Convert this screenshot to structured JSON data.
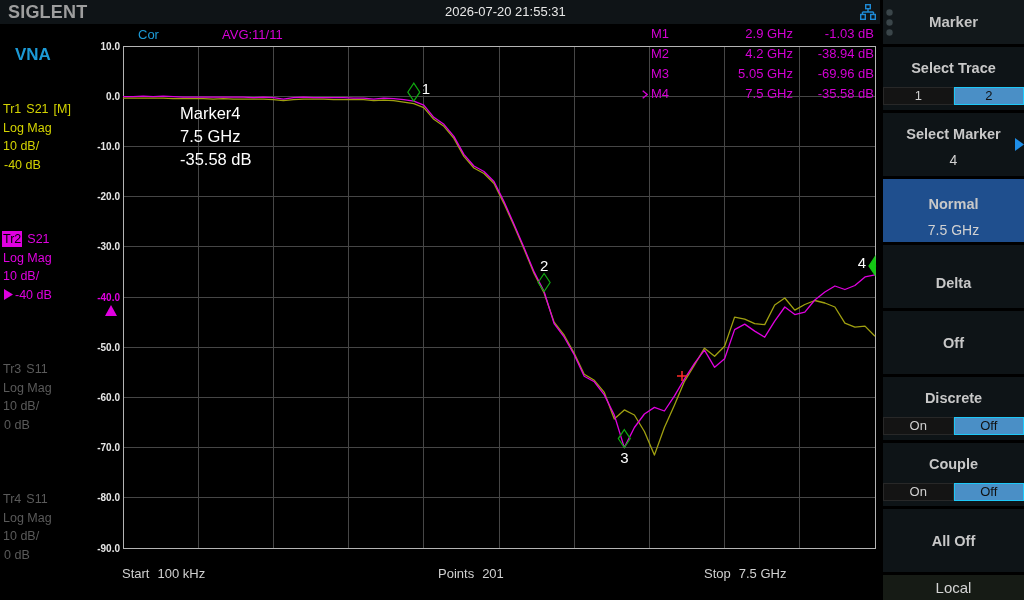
{
  "topbar": {
    "logo": "SIGLENT",
    "datetime": "2026-07-20 21:55:31"
  },
  "mode": "VNA",
  "traces": [
    {
      "name": "Tr1",
      "parameter": "S21",
      "flag": "[M]",
      "format": "Log Mag",
      "scale": "10 dB/",
      "reference": "-40 dB",
      "color": "#d4d400",
      "enabled": true,
      "selected": false
    },
    {
      "name": "Tr2",
      "parameter": "S21",
      "format": "Log Mag",
      "scale": "10 dB/",
      "reference": "-40 dB",
      "color": "#e000e0",
      "enabled": true,
      "selected": true
    },
    {
      "name": "Tr3",
      "parameter": "S11",
      "format": "Log Mag",
      "scale": "10 dB/",
      "reference": "0 dB",
      "enabled": false,
      "selected": false
    },
    {
      "name": "Tr4",
      "parameter": "S11",
      "format": "Log Mag",
      "scale": "10 dB/",
      "reference": "0 dB",
      "enabled": false,
      "selected": false
    }
  ],
  "plot": {
    "correction": "Cor",
    "averaging": "AVG:11/11",
    "markers": [
      {
        "name": "M1",
        "frequency": "2.9 GHz",
        "value": "-1.03 dB",
        "selected": false
      },
      {
        "name": "M2",
        "frequency": "4.2 GHz",
        "value": "-38.94 dB",
        "selected": false
      },
      {
        "name": "M3",
        "frequency": "5.05 GHz",
        "value": "-69.96 dB",
        "selected": false
      },
      {
        "name": "M4",
        "frequency": "7.5 GHz",
        "value": "-35.58 dB",
        "selected": true
      }
    ],
    "readout": {
      "title": "Marker4",
      "frequency": "7.5 GHz",
      "value": "-35.58 dB"
    },
    "chart_data": {
      "type": "line",
      "grid": true,
      "categories": [
        null,
        null,
        null,
        null,
        null,
        null,
        null,
        null,
        null,
        null,
        null,
        null,
        null,
        null,
        null,
        null,
        null,
        null,
        null,
        null,
        null,
        null,
        null,
        null,
        null,
        null,
        null,
        null,
        null,
        null,
        null,
        null,
        null,
        null,
        null,
        null,
        null,
        null,
        null,
        null,
        null,
        null,
        null,
        null,
        null,
        null,
        null,
        null,
        null,
        null,
        null,
        null,
        null,
        null,
        null,
        null,
        null,
        null,
        null,
        null,
        null,
        null,
        null,
        null,
        null,
        null,
        null,
        null,
        null,
        null,
        null,
        null,
        null,
        null,
        null,
        null
      ],
      "ylim": [
        -90,
        10
      ],
      "yticks": [
        {
          "value": 10,
          "label": "10.0"
        },
        {
          "value": 0,
          "label": "0.0"
        },
        {
          "value": -10,
          "label": "-10.0"
        },
        {
          "value": -20,
          "label": "-20.0"
        },
        {
          "value": -30,
          "label": "-30.0"
        },
        {
          "value": -40,
          "label": "-40.0"
        },
        {
          "value": -50,
          "label": "-50.0"
        },
        {
          "value": -60,
          "label": "-60.0"
        },
        {
          "value": -70,
          "label": "-70.0"
        },
        {
          "value": -80,
          "label": "-80.0"
        },
        {
          "value": -90,
          "label": "-90.0"
        }
      ],
      "series": [
        {
          "color": "#a0a010",
          "values": [
            -0.4,
            -0.4,
            -0.4,
            -0.4,
            -0.4,
            -0.5,
            -0.5,
            -0.5,
            -0.5,
            -0.6,
            -0.5,
            -0.6,
            -0.6,
            -0.6,
            -0.6,
            -0.7,
            -0.9,
            -0.7,
            -0.6,
            -0.6,
            -0.6,
            -0.7,
            -0.7,
            -0.7,
            -0.7,
            -0.9,
            -0.8,
            -0.9,
            -1.2,
            -1.5,
            -2.3,
            -4.6,
            -6.0,
            -8.4,
            -12.0,
            -14.3,
            -15.4,
            -17.4,
            -21.4,
            -25.8,
            -30.5,
            -35.3,
            -39.2,
            -45.0,
            -47.6,
            -51.2,
            -55.4,
            -56.6,
            -59.0,
            -64.3,
            -62.5,
            -63.5,
            -66.8,
            -71.5,
            -66.0,
            -61.5,
            -56.8,
            -53.5,
            -50.2,
            -51.8,
            -49.8,
            -44.0,
            -44.4,
            -45.3,
            -45.5,
            -41.6,
            -40.2,
            -42.6,
            -41.5,
            -40.7,
            -41.2,
            -42.0,
            -45.2,
            -46.0,
            -45.8,
            -47.8
          ]
        },
        {
          "color": "#e000e0",
          "values": [
            -0.1,
            -0.1,
            0.0,
            -0.1,
            0.0,
            -0.1,
            -0.2,
            -0.2,
            -0.2,
            -0.2,
            -0.2,
            -0.2,
            -0.2,
            -0.3,
            -0.2,
            -0.3,
            -0.6,
            -0.3,
            -0.2,
            -0.3,
            -0.3,
            -0.3,
            -0.3,
            -0.4,
            -0.4,
            -0.6,
            -0.4,
            -0.5,
            -0.7,
            -1.0,
            -1.8,
            -4.2,
            -5.6,
            -8.0,
            -11.6,
            -13.9,
            -15.0,
            -17.0,
            -21.0,
            -25.5,
            -30.2,
            -35.0,
            -38.9,
            -45.3,
            -48.0,
            -51.5,
            -55.8,
            -56.9,
            -59.5,
            -63.5,
            -70.0,
            -66.0,
            -63.3,
            -62.0,
            -62.7,
            -59.7,
            -56.3,
            -53.2,
            -50.6,
            -54.0,
            -52.3,
            -46.5,
            -45.4,
            -46.8,
            -48.0,
            -44.8,
            -42.0,
            -43.5,
            -43.0,
            -40.6,
            -39.0,
            -37.8,
            -38.5,
            -37.7,
            -36.0,
            -35.6
          ]
        }
      ],
      "annotations": [
        {
          "text": "1",
          "y": -1.0
        },
        {
          "text": "2",
          "y": -38.9
        },
        {
          "text": "3",
          "y": -70.0
        },
        {
          "text": "4",
          "y": -35.6
        }
      ]
    },
    "sweep": {
      "start_label": "Start",
      "start": "100 kHz",
      "points_label": "Points",
      "points": "201",
      "stop_label": "Stop",
      "stop": "7.5 GHz"
    }
  },
  "softkeys": {
    "title": "Marker",
    "items": [
      {
        "kind": "toggle",
        "label": "Select Trace",
        "selected": false,
        "options": [
          {
            "label": "1",
            "selected": false
          },
          {
            "label": "2",
            "selected": true
          }
        ]
      },
      {
        "kind": "submenu",
        "label": "Select Marker",
        "value": "4",
        "selected": false
      },
      {
        "kind": "mode",
        "label": "Normal",
        "value": "7.5 GHz",
        "selected": true
      },
      {
        "kind": "mode",
        "label": "Delta",
        "selected": false
      },
      {
        "kind": "plain",
        "label": "Off",
        "selected": false
      },
      {
        "kind": "toggle",
        "label": "Discrete",
        "selected": false,
        "options": [
          {
            "label": "On",
            "selected": false
          },
          {
            "label": "Off",
            "selected": true
          }
        ]
      },
      {
        "kind": "toggle",
        "label": "Couple",
        "selected": false,
        "options": [
          {
            "label": "On",
            "selected": false
          },
          {
            "label": "Off",
            "selected": true
          }
        ]
      },
      {
        "kind": "plain",
        "label": "All Off",
        "selected": false
      }
    ],
    "status": "Local"
  }
}
